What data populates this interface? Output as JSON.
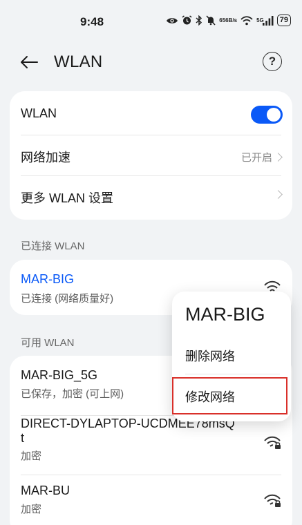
{
  "status_bar": {
    "time": "9:48",
    "net_speed_top": "656",
    "net_speed_bottom": "B/s",
    "signal_label": "5G",
    "battery": "79",
    "icons": [
      "eye-icon",
      "alarm-icon",
      "bluetooth-icon",
      "mute-icon",
      "wifi-icon",
      "signal-icon"
    ]
  },
  "header": {
    "title": "WLAN",
    "help_symbol": "?"
  },
  "settings_card": {
    "wlan_label": "WLAN",
    "wlan_enabled": true,
    "network_accel_label": "网络加速",
    "network_accel_value": "已开启",
    "more_settings_label": "更多 WLAN 设置"
  },
  "connected_section": {
    "header": "已连接 WLAN",
    "network_name": "MAR-BIG",
    "network_status": "已连接 (网络质量好)"
  },
  "available_section": {
    "header": "可用 WLAN",
    "networks": [
      {
        "name": "MAR-BIG_5G",
        "status": "已保存，加密 (可上网)"
      },
      {
        "name": "DIRECT-DYLAPTOP-UCDMEE78msQ",
        "name_cont": "t",
        "status": "加密"
      },
      {
        "name": "MAR-BU",
        "status": "加密"
      }
    ]
  },
  "popup_menu": {
    "title": "MAR-BIG",
    "items": [
      "删除网络",
      "修改网络"
    ]
  },
  "colors": {
    "accent": "#0a59f7",
    "highlight": "#d9302a",
    "background": "#f1f3f5"
  }
}
